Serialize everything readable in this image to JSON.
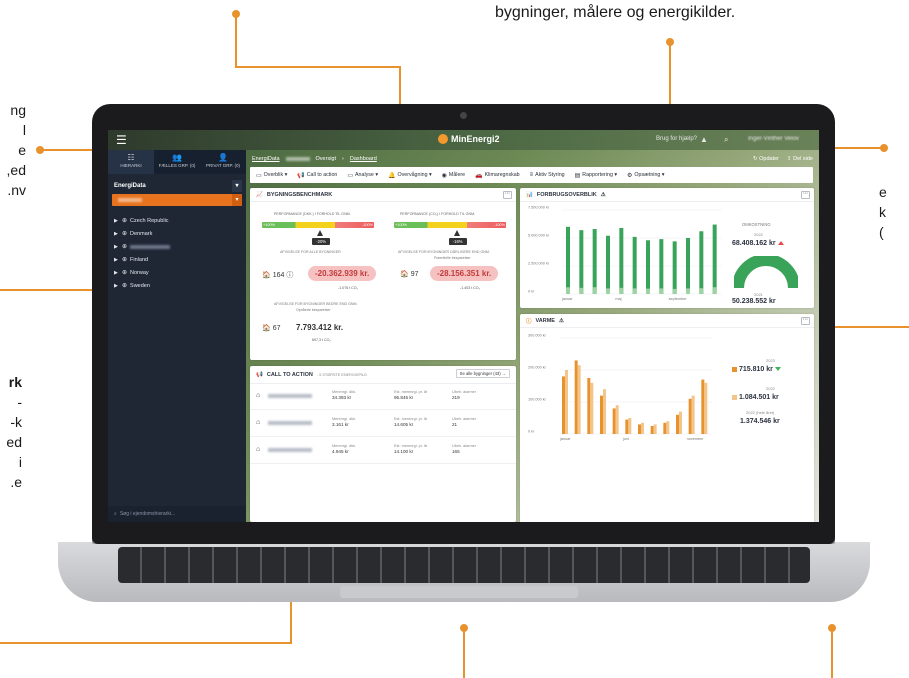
{
  "marketing": {
    "top_caption": "bygninger, målere og energikilder.",
    "left_top_fragment": "ng\nl\ne\ned,\nnv.",
    "left_bottom_bold": "rk",
    "left_bottom_fragment": "-\nk-\ned\ni\ne.",
    "right_fragment": "e\nk\n("
  },
  "header": {
    "logo_text": "MinEnergi2",
    "help_text": "Brug for hjælp?",
    "user_text": "Inger-Vinther Velov"
  },
  "sidebar": {
    "tabs": [
      {
        "label": "HIERARKI",
        "icon": "hierarchy-icon"
      },
      {
        "label": "FÆLLES GRP. (0)",
        "icon": "group-icon"
      },
      {
        "label": "PRIVAT GRP. (0)",
        "icon": "person-icon"
      }
    ],
    "selector_label": "EnergiData",
    "tree": [
      {
        "label": "Czech Republic",
        "blurred": false
      },
      {
        "label": "Denmark",
        "blurred": false
      },
      {
        "label": "",
        "blurred": true
      },
      {
        "label": "Finland",
        "blurred": false
      },
      {
        "label": "Norway",
        "blurred": false
      },
      {
        "label": "Sweden",
        "blurred": false
      }
    ],
    "search_placeholder": "Søg i ejendomshierarki..."
  },
  "breadcrumb": {
    "root": "EnergiData",
    "middle": "Oversigt",
    "current": "Dashboard"
  },
  "top_actions": {
    "update": "Opdater",
    "share": "Del side"
  },
  "nav": [
    {
      "label": "Overblik ▾",
      "icon": "monitor-icon"
    },
    {
      "label": "Call to action",
      "icon": "megaphone-icon"
    },
    {
      "label": "Analyse ▾",
      "icon": "monitor-icon"
    },
    {
      "label": "Overvågning ▾",
      "icon": "bell-icon"
    },
    {
      "label": "Målere",
      "icon": "gauge-icon"
    },
    {
      "label": "Klimaregnskab",
      "icon": "car-icon"
    },
    {
      "label": "Aktiv Styring",
      "icon": "list-icon"
    },
    {
      "label": "Rapportering ▾",
      "icon": "document-icon"
    },
    {
      "label": "Opsætning ▾",
      "icon": "gear-icon"
    }
  ],
  "benchmark": {
    "title": "BYGNINGSBENCHMARK",
    "left": {
      "perf_label": "PERFORMANCE (DKK.) I FORHOLD TIL GNM.",
      "low": "+100%",
      "high": "-100%",
      "marker": 0.52,
      "pct": "-20%",
      "deviation_label": "AFVIGELSE FOR ALLE BYGNINGER",
      "count": "164",
      "value": "-20.362.939 kr.",
      "co2": "-1.076 t CO₂"
    },
    "right": {
      "perf_label": "PERFORMANCE (CO₂) I FORHOLD TIL GNM.",
      "low": "+100%",
      "high": "-100%",
      "marker": 0.56,
      "pct": "-16%",
      "deviation_label": "AFVIGELSE FOR BYGNINGER DÅRLIGERE END GNM.",
      "sub_label": "Potentielle besparelser",
      "count": "97",
      "value": "-28.156.351 kr.",
      "co2": "-1.403 t CO₂"
    },
    "bottom": {
      "deviation_label": "AFVIGELSE FOR BYGNINGER BEDRE END GNM.",
      "sub_label": "Opnåede besparelser",
      "count": "67",
      "value": "7.793.412 kr.",
      "co2": "697,3 t CO₂"
    }
  },
  "cta": {
    "title": "CALL TO ACTION",
    "subtitle": "- 5 STØRSTE ENERGISPILD",
    "all_button": "Se alle bygninger (43) →",
    "col_headers": [
      "Merenrgi. dkk.",
      "Est. merenrgi. pr. år",
      "Ubeh. alarmer"
    ],
    "rows": [
      {
        "values": [
          "34.393 kr",
          "96.845 kr",
          "219"
        ]
      },
      {
        "values": [
          "3.161 kr",
          "14.605 kr",
          "21"
        ]
      },
      {
        "values": [
          "4.945 kr",
          "14.100 kr",
          "165"
        ]
      }
    ]
  },
  "forbrug": {
    "title": "FORBRUGSOVERBLIK",
    "kpi_title": "OMKOSTNING",
    "year_current": "2022",
    "value_current": "68.408.162 kr",
    "year_previous": "2021",
    "value_previous": "50.238.552 kr",
    "gauge_fraction": 1.0
  },
  "varme": {
    "title": "VARME",
    "year_a": "2023",
    "value_a": "715.810 kr",
    "year_b": "2022",
    "value_b": "1.084.501 kr",
    "year_c": "2022 (hele året)",
    "value_c": "1.374.546 kr"
  },
  "colors": {
    "accent_orange": "#e8922e",
    "bar_green": "#3aa35a",
    "bar_green_light": "#9dd3a3",
    "bar_orange": "#e8922e",
    "bar_orange_light": "#f3c58a",
    "sidebar_bg": "#1f2735"
  },
  "chart_data": [
    {
      "type": "bar",
      "title": "FORBRUGSOVERBLIK",
      "categories": [
        "januar",
        "",
        "",
        "",
        "maj",
        "",
        "",
        "",
        "september",
        "",
        "",
        ""
      ],
      "ylabel": "",
      "ylim": [
        0,
        7500000
      ],
      "yticks": [
        "7.500.000 kr",
        "5.000.000 kr",
        "2.500.000 kr",
        "0 kr"
      ],
      "series": [
        {
          "values": [
            6000000,
            5700000,
            5800000,
            5200000,
            5900000,
            5100000,
            4800000,
            4900000,
            4700000,
            5000000,
            5600000,
            6200000
          ]
        },
        {
          "values": [
            600000,
            550000,
            600000,
            500000,
            550000,
            500000,
            480000,
            500000,
            450000,
            500000,
            520000,
            600000
          ]
        }
      ]
    },
    {
      "type": "bar",
      "title": "VARME",
      "categories": [
        "januar",
        "",
        "",
        "",
        "",
        "juni",
        "",
        "",
        "",
        "",
        "november",
        ""
      ],
      "ylim": [
        0,
        300000
      ],
      "yticks": [
        "300.000 kr",
        "200.000 kr",
        "100.000 kr",
        "0 kr"
      ],
      "series": [
        {
          "values": [
            180000,
            230000,
            175000,
            120000,
            80000,
            45000,
            30000,
            25000,
            35000,
            60000,
            110000,
            170000
          ]
        },
        {
          "values": [
            200000,
            215000,
            160000,
            140000,
            90000,
            50000,
            35000,
            30000,
            40000,
            70000,
            120000,
            160000
          ]
        }
      ]
    }
  ]
}
